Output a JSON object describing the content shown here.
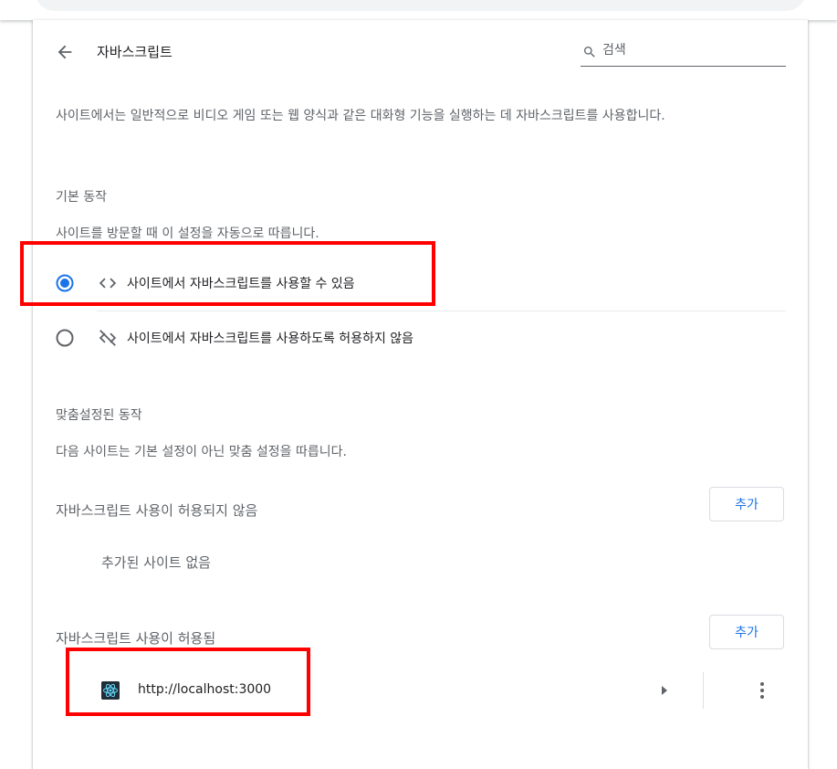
{
  "header": {
    "title": "자바스크립트",
    "search_placeholder": "검색"
  },
  "description": "사이트에서는 일반적으로 비디오 게임 또는 웹 양식과 같은 대화형 기능을 실행하는 데 자바스크립트를 사용합니다.",
  "default_behavior": {
    "heading": "기본 동작",
    "subheading": "사이트를 방문할 때 이 설정을 자동으로 따릅니다.",
    "options": [
      {
        "label": "사이트에서 자바스크립트를 사용할 수 있음",
        "selected": true,
        "icon": "code-icon"
      },
      {
        "label": "사이트에서 자바스크립트를 사용하도록 허용하지 않음",
        "selected": false,
        "icon": "code-off-icon"
      }
    ]
  },
  "custom_behavior": {
    "heading": "맞춤설정된 동작",
    "subheading": "다음 사이트는 기본 설정이 아닌 맞춤 설정을 따릅니다.",
    "blocked": {
      "title": "자바스크립트 사용이 허용되지 않음",
      "add_label": "추가",
      "empty_text": "추가된 사이트 없음"
    },
    "allowed": {
      "title": "자바스크립트 사용이 허용됨",
      "add_label": "추가",
      "sites": [
        {
          "url": "http://localhost:3000"
        }
      ]
    }
  },
  "colors": {
    "accent": "#1a73e8",
    "annotation": "#ff0000",
    "text_primary": "#202124",
    "text_secondary": "#5f6368"
  }
}
